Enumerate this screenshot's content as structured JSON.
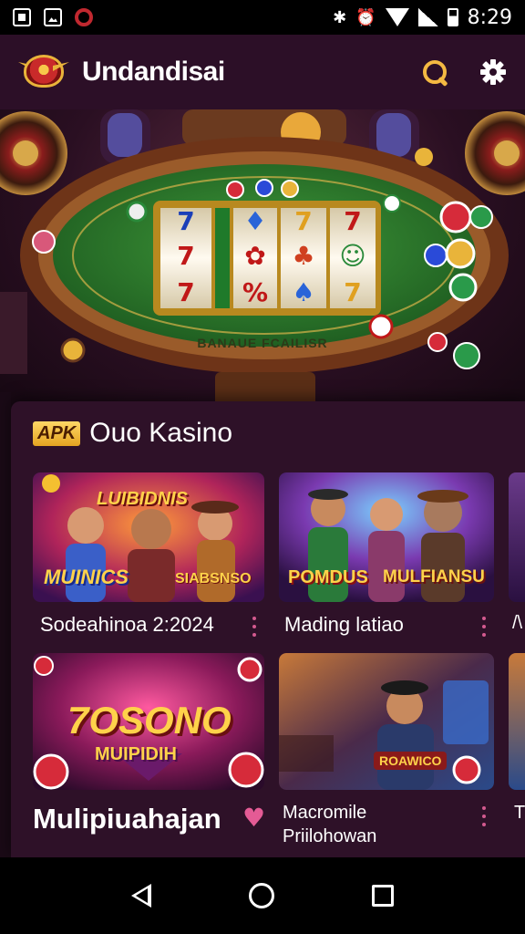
{
  "status_bar": {
    "time": "8:29",
    "left_icons": [
      "screenshot-icon",
      "photo-icon",
      "app-gear-icon"
    ],
    "right_icons": [
      "nfc-icon",
      "alarm-icon",
      "wifi-icon",
      "signal-icon",
      "battery-icon"
    ]
  },
  "app_bar": {
    "title": "Undandisai",
    "actions": [
      "search-icon",
      "gear-icon"
    ],
    "accent_color": "#f4b942",
    "background": "#2c0f27"
  },
  "hero": {
    "table_caption": "BANAUE FCAILISR",
    "reels": [
      [
        "7",
        "♦",
        "7",
        "7"
      ],
      [
        "7",
        "✿",
        "♣",
        "☺"
      ],
      [
        "7",
        "%",
        "♠",
        "7"
      ]
    ]
  },
  "section": {
    "badge": "APK",
    "title": "Ouo Kasino"
  },
  "cards": [
    {
      "label": "Sodeahinoa 2:2024",
      "banner": "MUINICS",
      "badge": "SIABSNSO",
      "top_text": "LUIBIDNIS"
    },
    {
      "label": "Mading latiao",
      "banner": "POMDUS",
      "badge": "MULFIANSU"
    },
    {
      "label": "Mulipiuahajan",
      "banner": "7OSONO",
      "sub_banner": "MUIPIDIH"
    },
    {
      "label_line1": "Macromile",
      "label_line2": "Priilohowan",
      "badge": "ROAWICO"
    }
  ],
  "peek_cards": [
    {
      "label": "/\\"
    },
    {
      "label": "T"
    }
  ],
  "nav_bar": {
    "buttons": [
      "back-icon",
      "home-icon",
      "recent-apps-icon"
    ]
  }
}
